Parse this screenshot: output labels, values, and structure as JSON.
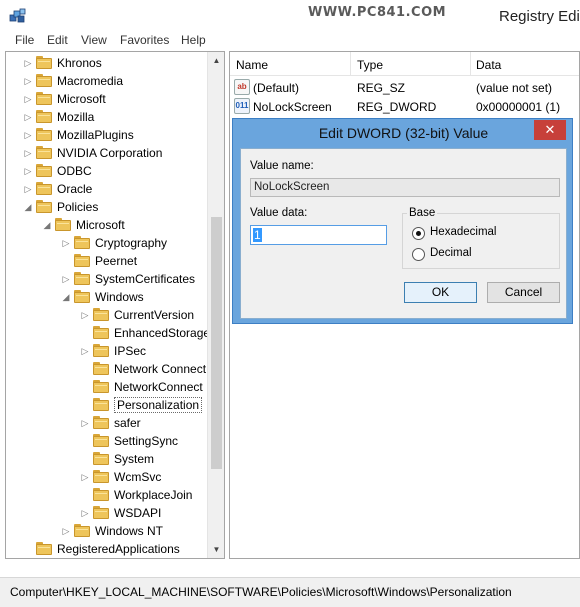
{
  "window": {
    "title": "Registry Edito",
    "watermark": "WWW.PC841.COM"
  },
  "menu": [
    "File",
    "Edit",
    "View",
    "Favorites",
    "Help"
  ],
  "tree": {
    "items": [
      {
        "label": "Khronos",
        "expander": "closed"
      },
      {
        "label": "Macromedia",
        "expander": "closed"
      },
      {
        "label": "Microsoft",
        "expander": "closed"
      },
      {
        "label": "Mozilla",
        "expander": "closed"
      },
      {
        "label": "MozillaPlugins",
        "expander": "closed"
      },
      {
        "label": "NVIDIA Corporation",
        "expander": "closed"
      },
      {
        "label": "ODBC",
        "expander": "closed"
      },
      {
        "label": "Oracle",
        "expander": "closed"
      },
      {
        "label": "Policies",
        "expander": "open"
      },
      {
        "label": "Microsoft",
        "expander": "open"
      },
      {
        "label": "Cryptography",
        "expander": "closed"
      },
      {
        "label": "Peernet",
        "expander": "none"
      },
      {
        "label": "SystemCertificates",
        "expander": "closed"
      },
      {
        "label": "Windows",
        "expander": "open"
      },
      {
        "label": "CurrentVersion",
        "expander": "closed"
      },
      {
        "label": "EnhancedStorage",
        "expander": "none"
      },
      {
        "label": "IPSec",
        "expander": "closed"
      },
      {
        "label": "Network Connect",
        "expander": "none"
      },
      {
        "label": "NetworkConnect",
        "expander": "none"
      },
      {
        "label": "Personalization",
        "expander": "none",
        "selected": true
      },
      {
        "label": "safer",
        "expander": "closed"
      },
      {
        "label": "SettingSync",
        "expander": "none"
      },
      {
        "label": "System",
        "expander": "none"
      },
      {
        "label": "WcmSvc",
        "expander": "closed"
      },
      {
        "label": "WorkplaceJoin",
        "expander": "none"
      },
      {
        "label": "WSDAPI",
        "expander": "closed"
      },
      {
        "label": "Windows NT",
        "expander": "closed"
      },
      {
        "label": "RegisteredApplications",
        "expander": "none"
      }
    ]
  },
  "list": {
    "columns": [
      "Name",
      "Type",
      "Data"
    ],
    "rows": [
      {
        "icon": "ab",
        "icon_name": "string-value-icon",
        "name": "(Default)",
        "type": "REG_SZ",
        "data": "(value not set)"
      },
      {
        "icon": "011",
        "icon_name": "dword-value-icon",
        "name": "NoLockScreen",
        "type": "REG_DWORD",
        "data": "0x00000001 (1)"
      }
    ]
  },
  "dialog": {
    "title": "Edit DWORD (32-bit) Value",
    "close_label": "✕",
    "value_name_label": "Value name:",
    "value_name": "NoLockScreen",
    "value_data_label": "Value data:",
    "value_data": "1",
    "base_label": "Base",
    "base_options": [
      "Hexadecimal",
      "Decimal"
    ],
    "base_selected": "Hexadecimal",
    "ok_label": "OK",
    "cancel_label": "Cancel"
  },
  "status": {
    "path": "Computer\\HKEY_LOCAL_MACHINE\\SOFTWARE\\Policies\\Microsoft\\Windows\\Personalization"
  },
  "colors": {
    "dialog_frame": "#6aa5dd",
    "close_button": "#c7403a",
    "selection": "#3399ff",
    "folder": "#eec55b"
  }
}
